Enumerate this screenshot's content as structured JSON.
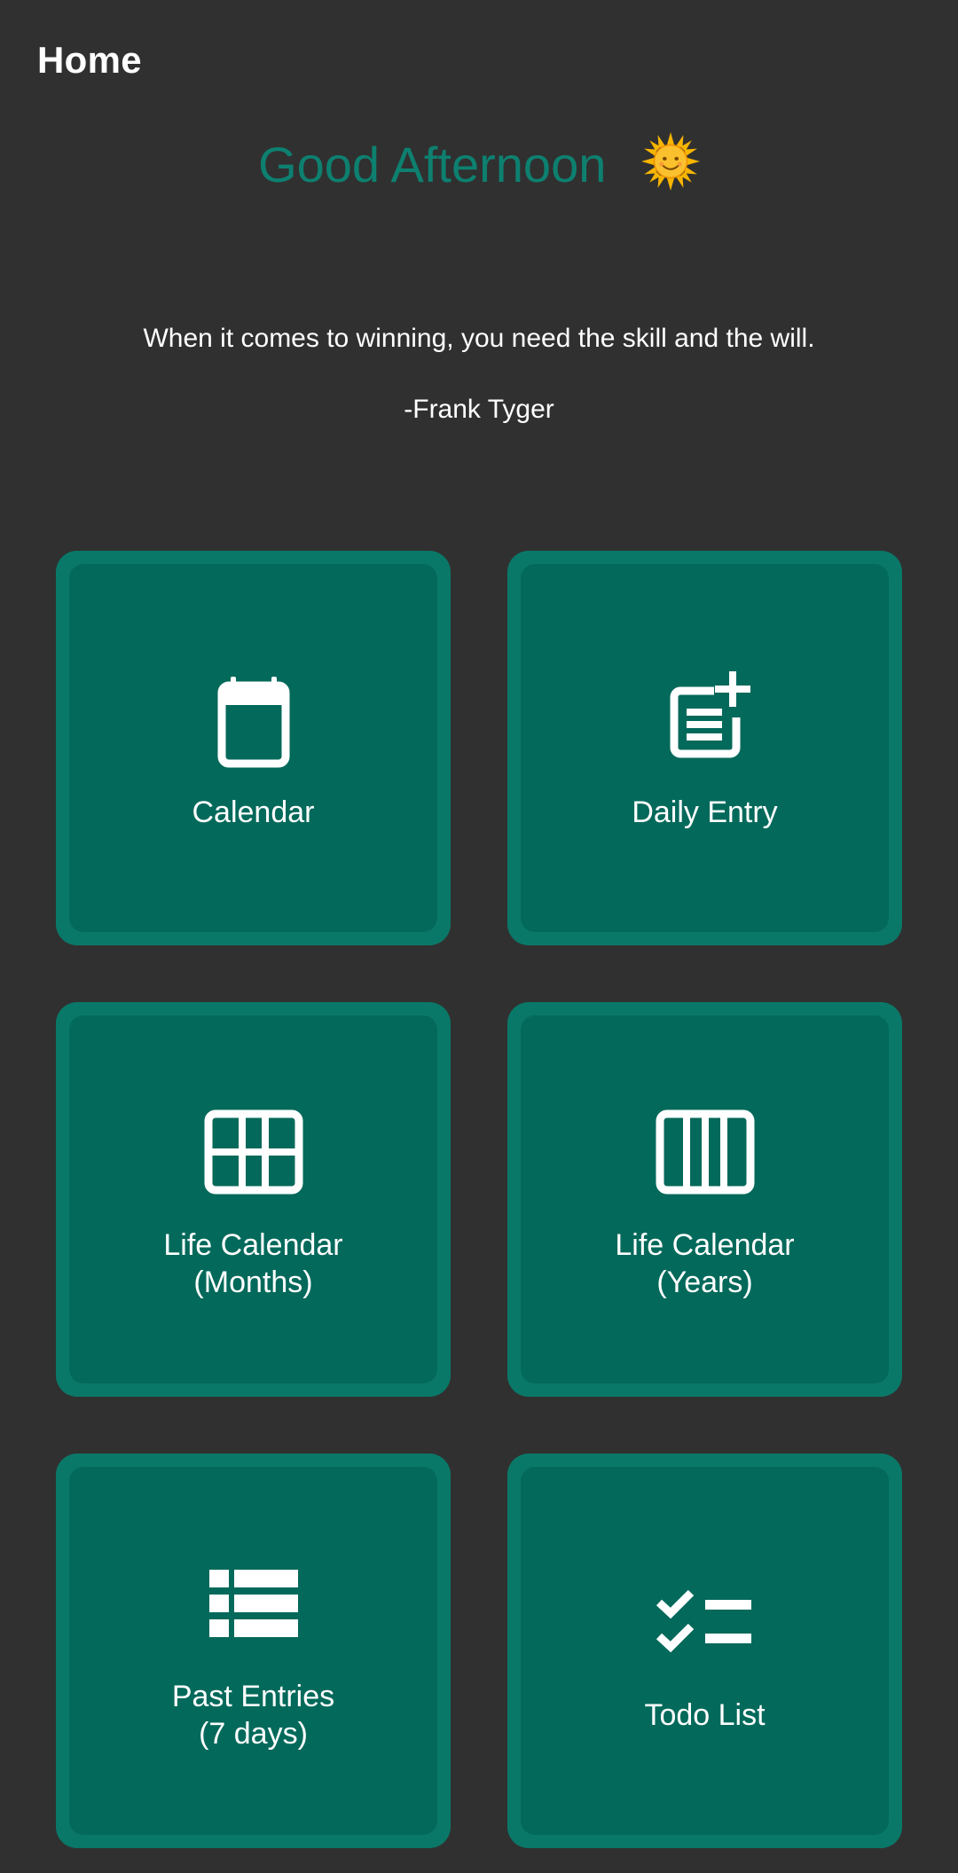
{
  "app_bar": {
    "title": "Home"
  },
  "greeting": {
    "text": "Good Afternoon",
    "icon": "sun-icon"
  },
  "quote": {
    "text": "When it comes to winning, you need the skill and the will.",
    "author": "-Frank Tyger"
  },
  "tiles": [
    {
      "label": "Calendar",
      "icon": "calendar-icon"
    },
    {
      "label": "Daily Entry",
      "icon": "post-add-icon"
    },
    {
      "label": "Life Calendar\n(Months)",
      "icon": "grid-icon"
    },
    {
      "label": "Life Calendar\n(Years)",
      "icon": "columns-icon"
    },
    {
      "label": "Past Entries\n(7 days)",
      "icon": "list-icon"
    },
    {
      "label": "Todo List",
      "icon": "checklist-icon"
    }
  ],
  "colors": {
    "background": "#303030",
    "accent": "#0d8070",
    "tile_border": "#0a7868",
    "tile_fill": "#03695b"
  }
}
